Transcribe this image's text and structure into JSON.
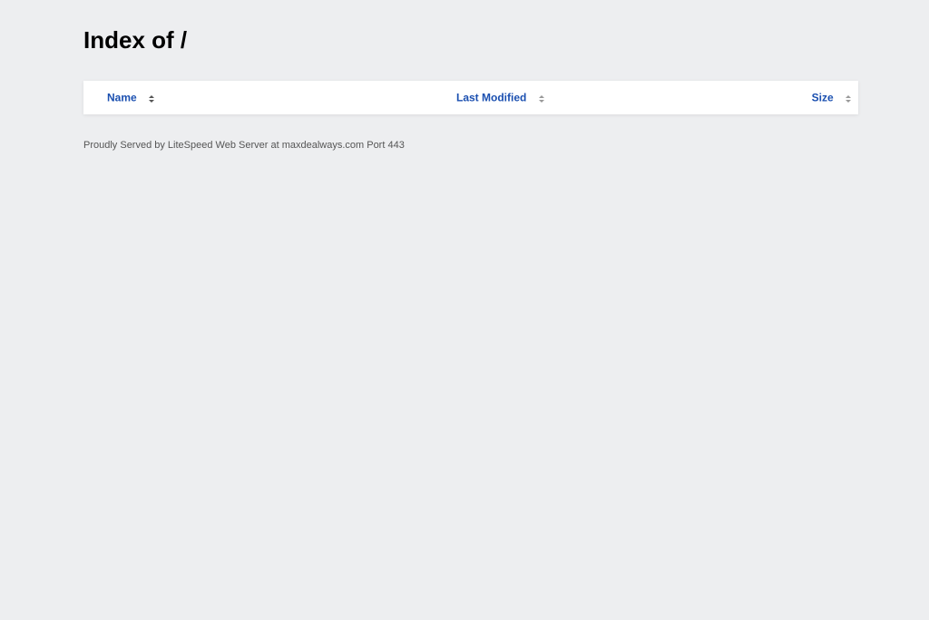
{
  "page": {
    "title": "Index of /"
  },
  "table": {
    "columns": [
      {
        "label": "Name",
        "sort_icon": "sort-icon"
      },
      {
        "label": "Last Modified",
        "sort_icon": "sort-icon"
      },
      {
        "label": "Size",
        "sort_icon": "sort-icon"
      }
    ],
    "rows": []
  },
  "footer": {
    "text": "Proudly Served by LiteSpeed Web Server at maxdealways.com Port 443"
  },
  "colors": {
    "background": "#edeef0",
    "link": "#1a4fb0",
    "table_bg": "#ffffff"
  }
}
